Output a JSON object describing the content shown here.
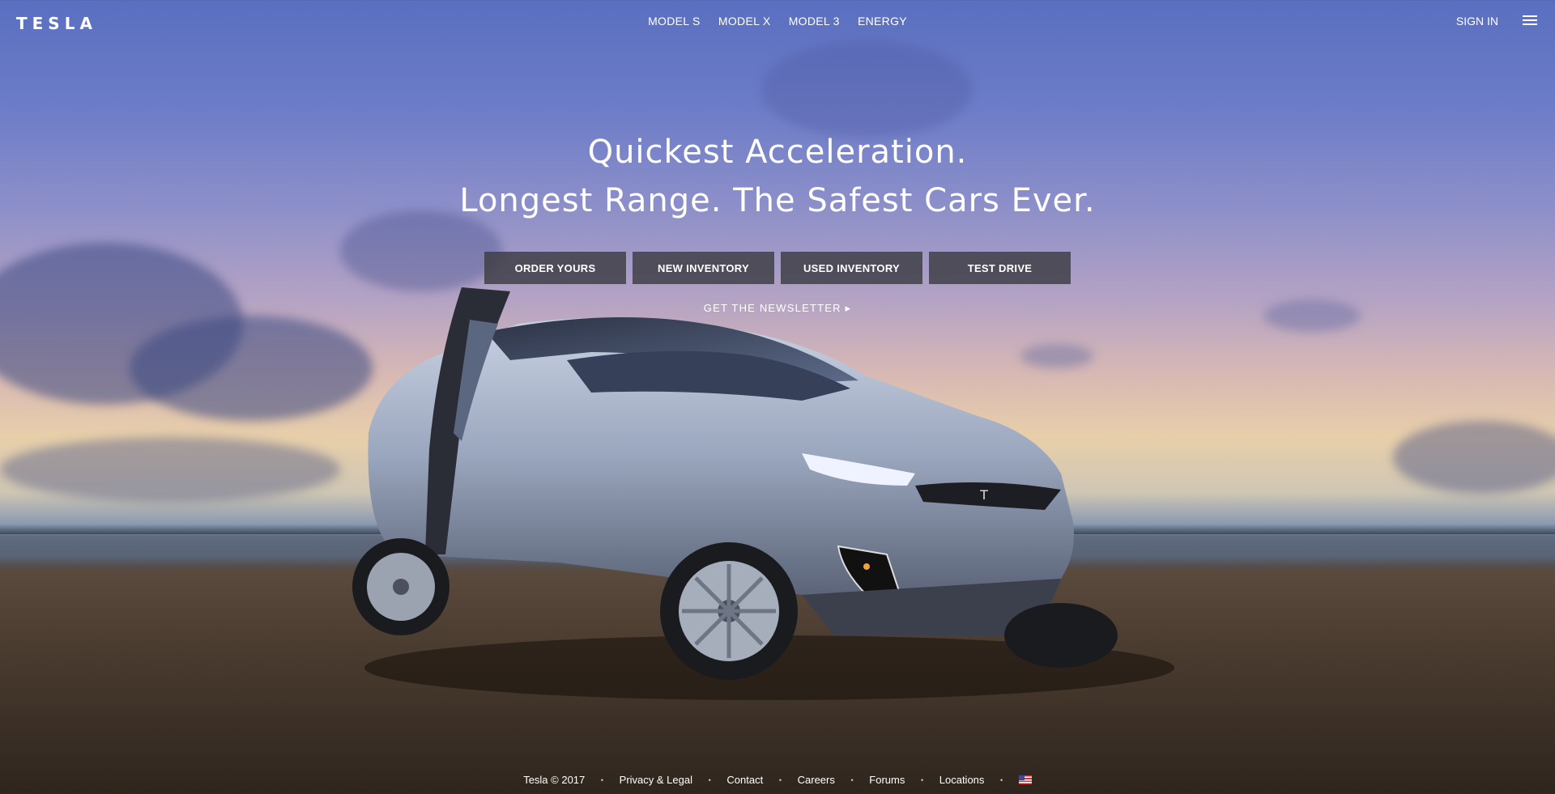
{
  "header": {
    "logo_text": "TESLA",
    "nav": [
      "MODEL S",
      "MODEL X",
      "MODEL 3",
      "ENERGY"
    ],
    "sign_in": "SIGN IN",
    "menu_icon": "hamburger-menu-icon"
  },
  "hero": {
    "line1": "Quickest Acceleration.",
    "line2": "Longest Range. The Safest Cars Ever.",
    "buttons": [
      "ORDER YOURS",
      "NEW INVENTORY",
      "USED INVENTORY",
      "TEST DRIVE"
    ],
    "newsletter": "GET THE NEWSLETTER ▸"
  },
  "footer": {
    "copyright": "Tesla © 2017",
    "links": [
      "Privacy & Legal",
      "Contact",
      "Careers",
      "Forums",
      "Locations"
    ],
    "separator": "•",
    "region_icon": "us-flag-icon"
  },
  "colors": {
    "sky_top": "#5a6fc0",
    "horizon": "#e8cfaa",
    "sand": "#4a3b2f",
    "button_bg": "#3c3c42"
  }
}
